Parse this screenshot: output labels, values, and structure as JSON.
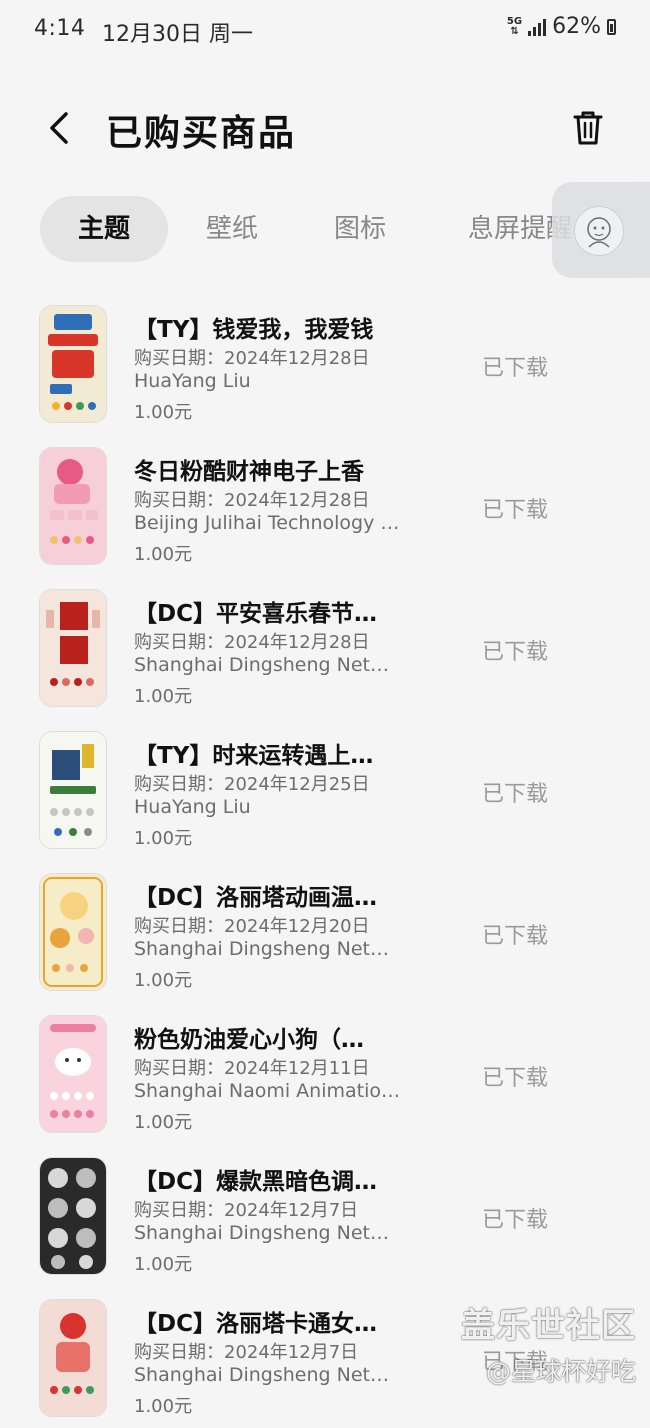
{
  "status_bar": {
    "time": "4:14",
    "date": "12月30日 周一",
    "network": "5G",
    "battery": "62%"
  },
  "header": {
    "title": "已购买商品",
    "back_icon": "chevron-left-icon",
    "trash_icon": "trash-icon"
  },
  "tabs": [
    {
      "label": "主题",
      "active": true
    },
    {
      "label": "壁纸",
      "active": false
    },
    {
      "label": "图标",
      "active": false
    },
    {
      "label": "息屏提醒",
      "active": false
    }
  ],
  "items": [
    {
      "title": "【TY】钱爱我，我爱钱",
      "date": "购买日期：2024年12月28日",
      "author": "HuaYang Liu",
      "price": "1.00元",
      "status": "已下载",
      "thumb_color": "#f3ead3",
      "accent": "#d9362b"
    },
    {
      "title": "冬日粉酷财神电子上香",
      "date": "购买日期：2024年12月28日",
      "author": "Beijing Julihai Technology …",
      "price": "1.00元",
      "status": "已下载",
      "thumb_color": "#f7cfd9",
      "accent": "#e85a86"
    },
    {
      "title": "【DC】平安喜乐春节…",
      "date": "购买日期：2024年12月28日",
      "author": "Shanghai Dingsheng Net…",
      "price": "1.00元",
      "status": "已下载",
      "thumb_color": "#f4e6dc",
      "accent": "#b8211c"
    },
    {
      "title": "【TY】时来运转遇上…",
      "date": "购买日期：2024年12月25日",
      "author": "HuaYang Liu",
      "price": "1.00元",
      "status": "已下载",
      "thumb_color": "#f7f7f2",
      "accent": "#3b7d3a"
    },
    {
      "title": "【DC】洛丽塔动画温…",
      "date": "购买日期：2024年12月20日",
      "author": "Shanghai Dingsheng Net…",
      "price": "1.00元",
      "status": "已下载",
      "thumb_color": "#f6edc8",
      "accent": "#e7a43a"
    },
    {
      "title": "粉色奶油爱心小狗（…",
      "date": "购买日期：2024年12月11日",
      "author": "Shanghai Naomi Animatio…",
      "price": "1.00元",
      "status": "已下载",
      "thumb_color": "#f9d4de",
      "accent": "#ee7fa0"
    },
    {
      "title": "【DC】爆款黑暗色调…",
      "date": "购买日期：2024年12月7日",
      "author": "Shanghai Dingsheng Net…",
      "price": "1.00元",
      "status": "已下载",
      "thumb_color": "#2a2a2a",
      "accent": "#d8d8d8"
    },
    {
      "title": "【DC】洛丽塔卡通女…",
      "date": "购买日期：2024年12月7日",
      "author": "Shanghai Dingsheng Net…",
      "price": "1.00元",
      "status": "已下载",
      "thumb_color": "#f4dcd6",
      "accent": "#d8332e"
    }
  ],
  "watermark": {
    "logo": "盖乐世社区",
    "user": "@星球杯好吃"
  }
}
